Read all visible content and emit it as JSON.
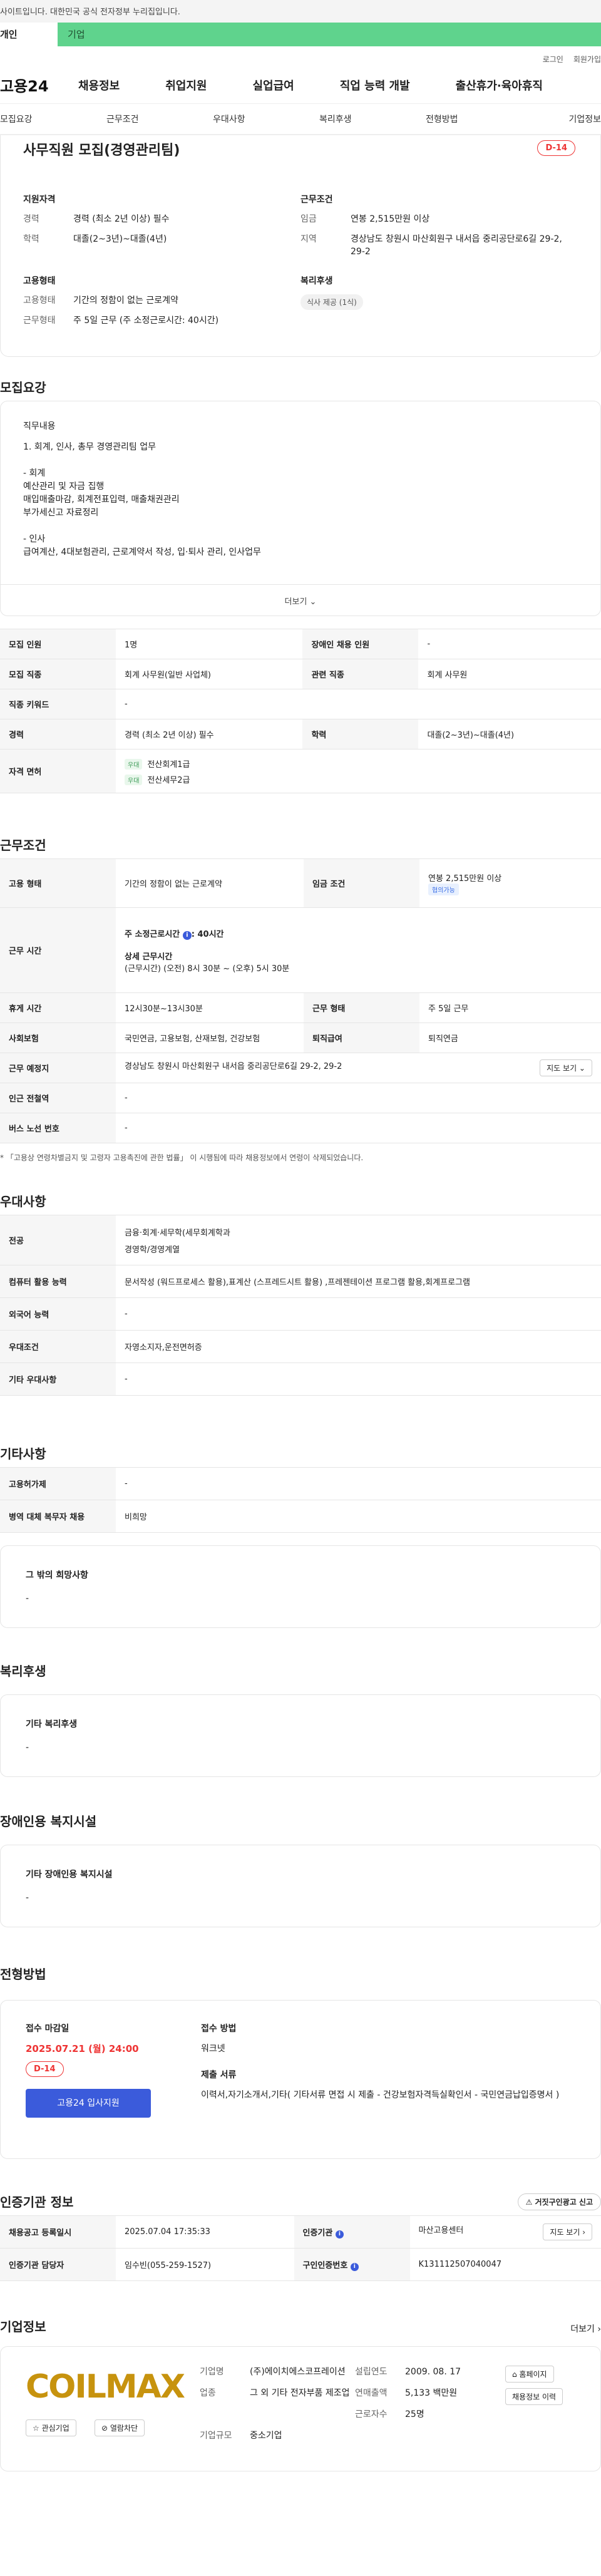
{
  "gov_bar": "사이트입니다. 대한민국 공식 전자정부 누리집입니다.",
  "top_tabs": [
    "개인",
    "기업"
  ],
  "util": [
    "로그인",
    "회원가입"
  ],
  "site_logo": "고용24",
  "gnb": [
    "채용정보",
    "취업지원",
    "실업급여",
    "직업 능력 개발",
    "출산휴가·육아휴직"
  ],
  "subnav": [
    "모집요강",
    "근무조건",
    "우대사항",
    "복리후생",
    "전형방법",
    "기업정보"
  ],
  "summary": {
    "title": "사무직원 모집(경영관리팀)",
    "dday": "D-14",
    "req_h": "지원자격",
    "req": [
      [
        "경력",
        "경력 (최소 2년 이상) 필수"
      ],
      [
        "학력",
        "대졸(2~3년)~대졸(4년)"
      ]
    ],
    "cond_h": "근무조건",
    "cond": [
      [
        "임금",
        "연봉 2,515만원 이상"
      ],
      [
        "지역",
        "경상남도 창원시 마산회원구 내서읍 중리공단로6길 29-2, 29-2"
      ]
    ],
    "emp_h": "고용형태",
    "emp": [
      [
        "고용형태",
        "기간의 정함이 없는 근로계약"
      ],
      [
        "근무형태",
        "주 5일 근무 (주 소정근로시간: 40시간)"
      ]
    ],
    "welfare_h": "복리후생",
    "welfare_chip": "식사 제공 (1식)"
  },
  "sec": {
    "recruit": "모집요강",
    "workcond": "근무조건",
    "pref": "우대사항",
    "etc": "기타사항",
    "welfare": "복리후생",
    "disabled": "장애인용 복지시설",
    "process": "전형방법",
    "cert": "인증기관 정보",
    "company": "기업정보"
  },
  "duty": {
    "label": "직무내용",
    "lines": [
      "1. 회계, 인사, 총무 경영관리팀 업무",
      "",
      "- 회계",
      "예산관리 및 자금 집행",
      "매입매출마감, 회계전표입력, 매출채권관리",
      "부가세신고 자료정리",
      "",
      "- 인사",
      "급여계산, 4대보험관리, 근로계약서 작성, 입·퇴사 관리, 인사업무"
    ],
    "more": "더보기 ⌄"
  },
  "recruit_table": {
    "r1": [
      "모집 인원",
      "1명",
      "장애인 채용 인원",
      "-"
    ],
    "r2": [
      "모집 직종",
      "회계 사무원(일반 사업체)",
      "관련 직종",
      "회계 사무원"
    ],
    "r3": [
      "직종 키워드",
      "-"
    ],
    "r4": [
      "경력",
      "경력 (최소 2년 이상) 필수",
      "학력",
      "대졸(2~3년)~대졸(4년)"
    ],
    "r5h": "자격 면허",
    "lic_tag": "우대",
    "lic": [
      "전산회계1급",
      "전산세무2급"
    ]
  },
  "work_table": {
    "emp": [
      "고용 형태",
      "기간의 정함이 없는 근로계약",
      "임금 조건",
      "연봉 2,515만원 이상"
    ],
    "wage_tag": "협의가능",
    "time_h": "근무 시간",
    "time_a": "주 소정근로시간",
    "time_a_v": ": 40시간",
    "time_b": "상세 근무시간",
    "time_c": "(근무시간) (오전) 8시 30분 ~ (오후) 5시 30분",
    "rest": [
      "휴게 시간",
      "12시30분~13시30분",
      "근무 형태",
      "주 5일 근무"
    ],
    "ins": [
      "사회보험",
      "국민연금, 고용보험, 산재보험, 건강보험",
      "퇴직급여",
      "퇴직연금"
    ],
    "place": [
      "근무 예정지",
      "경상남도 창원시 마산회원구 내서읍 중리공단로6길 29-2, 29-2"
    ],
    "map_btn": "지도 보기 ⌄",
    "subway": [
      "인근 전철역",
      "-"
    ],
    "bus": [
      "버스 노선 번호",
      "-"
    ],
    "note": "* 「고용상 연령차별금지 및 고령자 고용촉진에 관한 법률」 이 시행됨에 따라 채용정보에서 연령이 삭제되었습니다."
  },
  "pref_table": {
    "major": [
      "전공",
      "금융·회계·세무학(세무회계학과",
      "경영학/경영계열"
    ],
    "comp": [
      "컴퓨터 활용 능력",
      "문서작성 (워드프로세스 활용),표계산 (스프레드시트 활용) ,프레젠테이션 프로그램 활용,회계프로그램"
    ],
    "lang": [
      "외국어 능력",
      "-"
    ],
    "cond": [
      "우대조건",
      "자영소지자,운전면허증"
    ],
    "etc": [
      "기타 우대사항",
      "-"
    ]
  },
  "etc_table": {
    "r1": [
      "고용허가제",
      "-"
    ],
    "r2": [
      "병역 대체 복무자 채용",
      "비희망"
    ],
    "hope_l": "그 밖의 희망사항",
    "hope_v": "-"
  },
  "welfare_box": {
    "l": "기타 복리후생",
    "v": "-"
  },
  "disabled_box": {
    "l": "기타 장애인용 복지시설",
    "v": "-"
  },
  "process": {
    "deadline_l": "접수 마감일",
    "deadline": "2025.07.21 (월) 24:00",
    "dday": "D-14",
    "apply_btn": "고용24 입사지원",
    "method_l": "접수 방법",
    "method": "워크넷",
    "docs_l": "제출 서류",
    "docs": "이력서,자기소개서,기타( 기타서류 면접 시 제출 - 건강보험자격득실확인서 - 국민연금납입증명서 )"
  },
  "cert": {
    "btn": "⚠ 거짓구인광고 신고",
    "r1": [
      "채용공고 등록일시",
      "2025.07.04 17:35:33",
      "인증기관",
      "마산고용센터"
    ],
    "map_btn": "지도 보기 ›",
    "r2": [
      "인증기관 담당자",
      "임수빈(055-259-1527)",
      "구인인증번호",
      "K131112507040047"
    ]
  },
  "company": {
    "more": "더보기 ›",
    "logo": "COILMAX",
    "fav": "☆ 관심기업",
    "block": "⊘ 열람차단",
    "fields": [
      [
        "기업명",
        "(주)에이치에스코프레이션",
        "설립연도",
        "2009. 08. 17"
      ],
      [
        "업종",
        "그 외 기타 전자부품 제조업",
        "연매출액",
        "5,133 백만원"
      ],
      [
        "",
        "",
        "근로자수",
        "25명"
      ],
      [
        "기업규모",
        "중소기업",
        "",
        ""
      ]
    ],
    "home": "⌂ 홈페이지",
    "recruits": "채용정보 이력"
  }
}
